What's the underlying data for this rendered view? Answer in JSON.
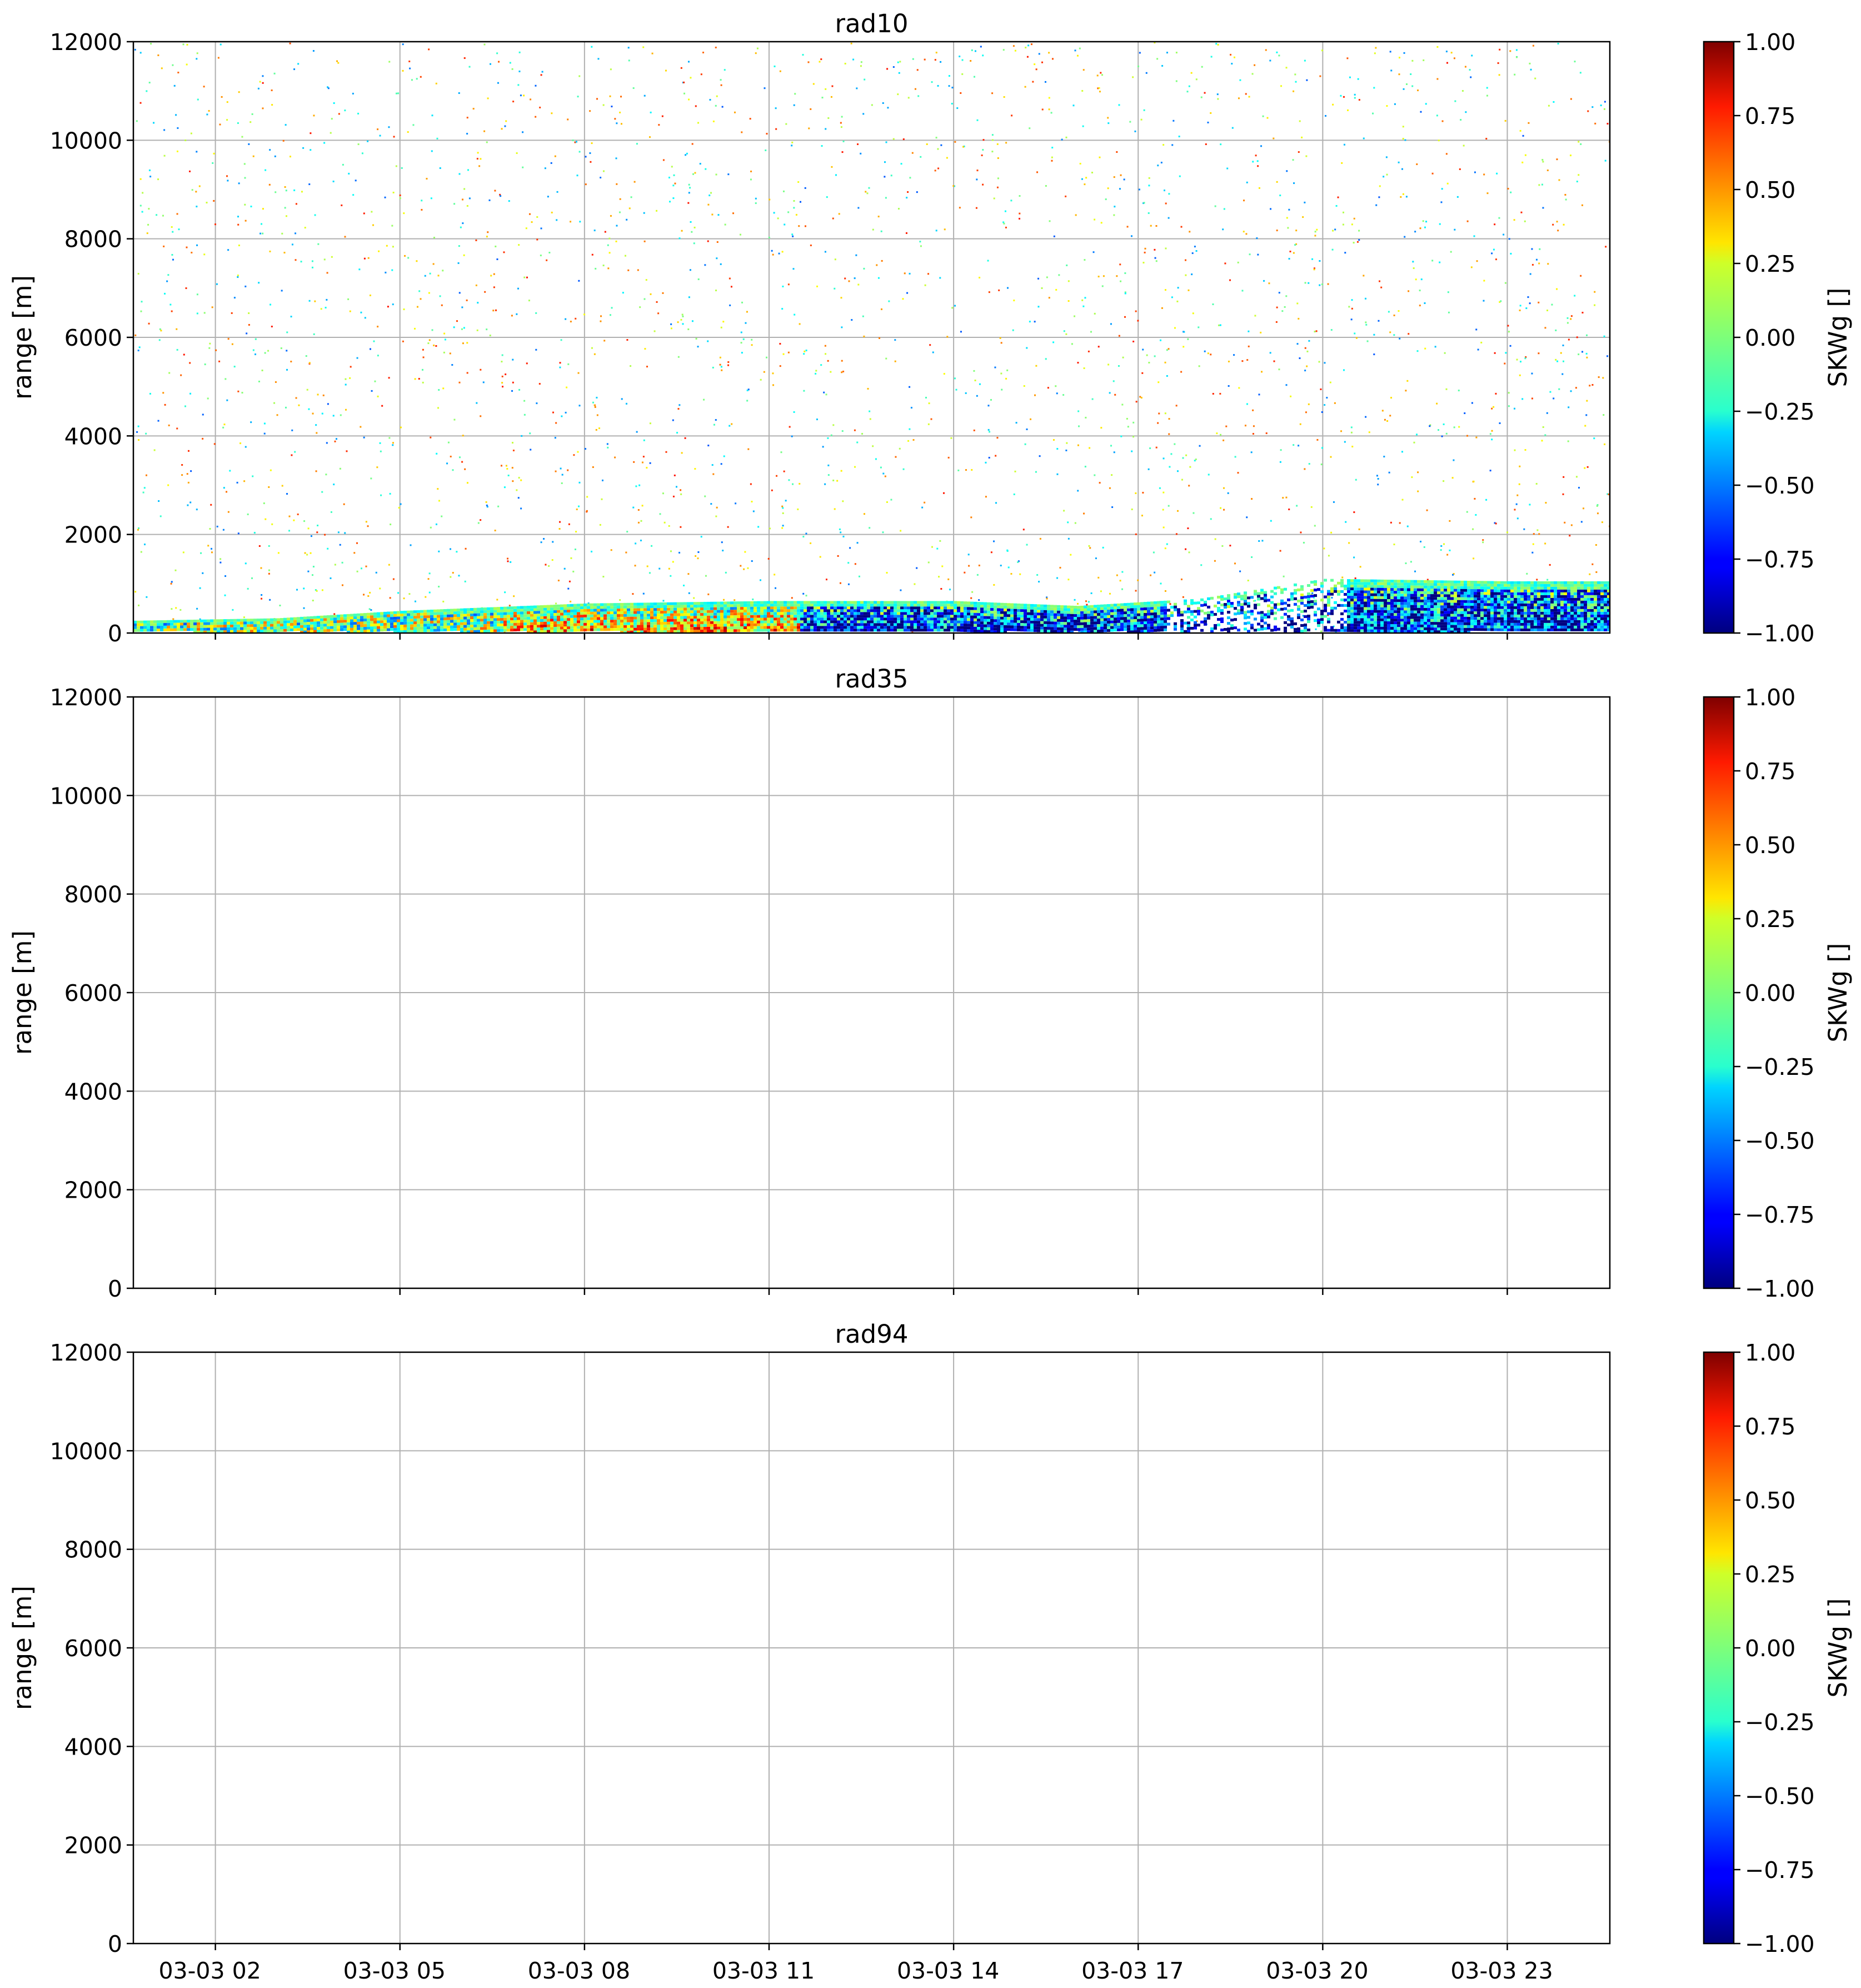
{
  "chart_data": [
    {
      "type": "heatmap",
      "title": "rad10",
      "ylabel": "range [m]",
      "xlabel": "",
      "ylim": [
        0,
        12000
      ],
      "xlim": [
        "2023-03-03 00:40",
        "2023-03-04 00:40"
      ],
      "yticks": [
        0,
        2000,
        4000,
        6000,
        8000,
        10000,
        12000
      ],
      "xticks": [
        {
          "t": "2023-03-03 02:00",
          "label": "03-03 02"
        },
        {
          "t": "2023-03-03 05:00",
          "label": "03-03 05"
        },
        {
          "t": "2023-03-03 08:00",
          "label": "03-03 08"
        },
        {
          "t": "2023-03-03 11:00",
          "label": "03-03 11"
        },
        {
          "t": "2023-03-03 14:00",
          "label": "03-03 14"
        },
        {
          "t": "2023-03-03 17:00",
          "label": "03-03 17"
        },
        {
          "t": "2023-03-03 20:00",
          "label": "03-03 20"
        },
        {
          "t": "2023-03-03 23:00",
          "label": "03-03 23"
        }
      ],
      "show_xtick_labels": false,
      "grid": true,
      "colorbar": {
        "label": "SKWg []",
        "colormap": "jet",
        "range": [
          -1.0,
          1.0
        ],
        "ticks": [
          "1.00",
          "0.75",
          "0.50",
          "0.25",
          "0.00",
          "−0.25",
          "−0.50",
          "−0.75",
          "−1.00"
        ]
      },
      "data_description": "sparse noise throughout; dense low-level echo layer",
      "layer_top": [
        {
          "t": "2023-03-03 00:40",
          "range_m": 250
        },
        {
          "t": "2023-03-03 03:00",
          "range_m": 300
        },
        {
          "t": "2023-03-03 05:00",
          "range_m": 450
        },
        {
          "t": "2023-03-03 08:00",
          "range_m": 600
        },
        {
          "t": "2023-03-03 11:00",
          "range_m": 650
        },
        {
          "t": "2023-03-03 14:00",
          "range_m": 650
        },
        {
          "t": "2023-03-03 16:00",
          "range_m": 550
        },
        {
          "t": "2023-03-03 18:00",
          "range_m": 700
        },
        {
          "t": "2023-03-03 20:00",
          "range_m": 1100
        },
        {
          "t": "2023-03-03 23:00",
          "range_m": 1050
        },
        {
          "t": "2023-03-04 00:40",
          "range_m": 1050
        }
      ]
    },
    {
      "type": "heatmap",
      "title": "rad35",
      "ylabel": "range [m]",
      "xlabel": "",
      "ylim": [
        0,
        12000
      ],
      "yticks": [
        0,
        2000,
        4000,
        6000,
        8000,
        10000,
        12000
      ],
      "show_xtick_labels": false,
      "grid": true,
      "colorbar": {
        "label": "SKWg []",
        "colormap": "jet",
        "range": [
          -1.0,
          1.0
        ],
        "ticks": [
          "1.00",
          "0.75",
          "0.50",
          "0.25",
          "0.00",
          "−0.25",
          "−0.50",
          "−0.75",
          "−1.00"
        ]
      },
      "data_description": "empty"
    },
    {
      "type": "heatmap",
      "title": "rad94",
      "ylabel": "range [m]",
      "xlabel": "",
      "ylim": [
        0,
        12000
      ],
      "yticks": [
        0,
        2000,
        4000,
        6000,
        8000,
        10000,
        12000
      ],
      "show_xtick_labels": true,
      "grid": true,
      "colorbar": {
        "label": "SKWg []",
        "colormap": "jet",
        "range": [
          -1.0,
          1.0
        ],
        "ticks": [
          "1.00",
          "0.75",
          "0.50",
          "0.25",
          "0.00",
          "−0.25",
          "−0.50",
          "−0.75",
          "−1.00"
        ]
      },
      "data_description": "empty"
    }
  ]
}
